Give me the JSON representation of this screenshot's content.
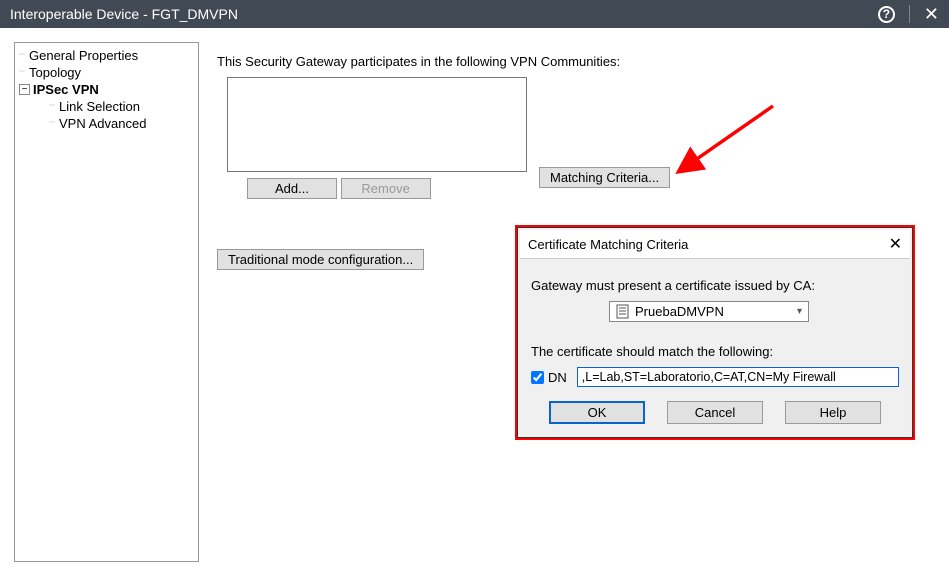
{
  "titlebar": {
    "title": "Interoperable Device - FGT_DMVPN"
  },
  "tree": {
    "items": [
      {
        "label": "General Properties"
      },
      {
        "label": "Topology"
      },
      {
        "label": "IPSec VPN",
        "selected": true,
        "expandable": true
      },
      {
        "label": "Link Selection",
        "child": true
      },
      {
        "label": "VPN Advanced",
        "child": true
      }
    ]
  },
  "main": {
    "heading": "This Security Gateway participates in the following VPN Communities:",
    "add_label": "Add...",
    "remove_label": "Remove",
    "matching_label": "Matching Criteria...",
    "traditional_label": "Traditional mode configuration..."
  },
  "dialog": {
    "title": "Certificate Matching Criteria",
    "line1": "Gateway must present a certificate issued by CA:",
    "ca_selected": "PruebaDMVPN",
    "line2": "The certificate should match the following:",
    "dn_label": "DN",
    "dn_checked": true,
    "dn_value": ",L=Lab,ST=Laboratorio,C=AT,CN=My Firewall",
    "ok_label": "OK",
    "cancel_label": "Cancel",
    "help_label": "Help"
  }
}
